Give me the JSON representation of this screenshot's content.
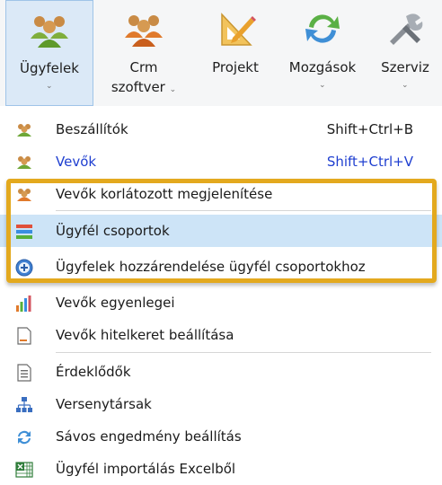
{
  "ribbon": {
    "buttons": [
      {
        "label": "Ügyfelek",
        "icon": "customers-icon",
        "active": true
      },
      {
        "label": "Crm",
        "label2": "szoftver",
        "icon": "crm-icon"
      },
      {
        "label": "Projekt",
        "icon": "project-icon"
      },
      {
        "label": "Mozgások",
        "icon": "movements-icon"
      },
      {
        "label": "Szerviz",
        "icon": "service-icon"
      }
    ],
    "chevron": "⌄"
  },
  "menu": {
    "items": [
      {
        "label": "Beszállítók",
        "shortcut": "Shift+Ctrl+B",
        "icon": "suppliers-icon"
      },
      {
        "label": "Vevők",
        "shortcut": "Shift+Ctrl+V",
        "icon": "buyers-icon"
      },
      {
        "label": "Vevők korlátozott megjelenítése",
        "icon": "buyers-limited-icon"
      },
      {
        "label": "Ügyfél csoportok",
        "icon": "customer-groups-icon"
      },
      {
        "label": "Ügyfelek hozzárendelése ügyfél csoportokhoz",
        "icon": "assign-group-icon"
      },
      {
        "label": "Vevők egyenlegei",
        "icon": "bar-chart-icon"
      },
      {
        "label": "Vevők hitelkeret beállítása",
        "icon": "document-icon"
      },
      {
        "label": "Érdeklődők",
        "icon": "list-document-icon"
      },
      {
        "label": "Versenytársak",
        "icon": "hierarchy-icon"
      },
      {
        "label": "Sávos engedmény beállítás",
        "icon": "refresh-icon"
      },
      {
        "label": "Ügyfél importálás Excelből",
        "icon": "excel-icon"
      }
    ]
  },
  "colors": {
    "highlight_frame": "#e3a91e",
    "link_text": "#1f3fd0",
    "hover_bg": "#cde4f7"
  }
}
